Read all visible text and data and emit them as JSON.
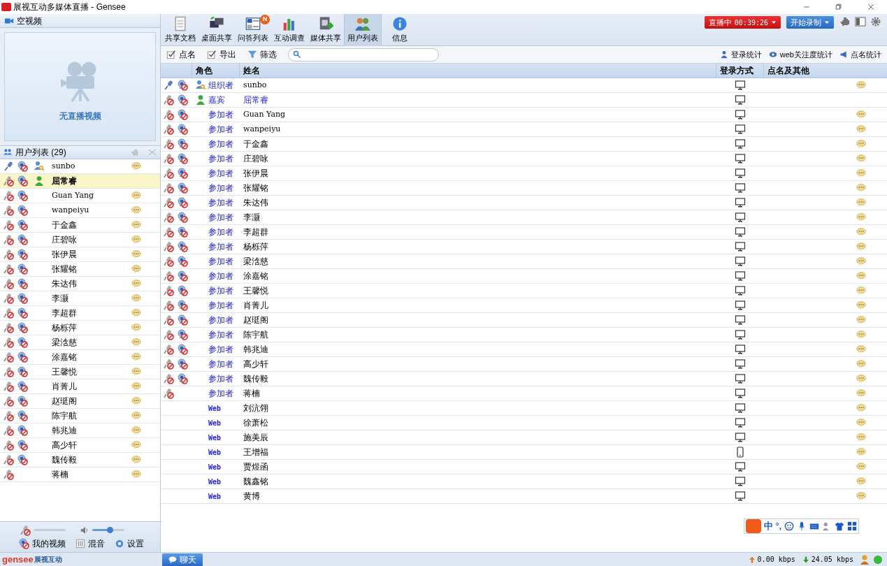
{
  "window": {
    "title": "展视互动多媒体直播 - Gensee"
  },
  "video_panel": {
    "title": "空视频",
    "empty_text": "无直播视频"
  },
  "user_panel": {
    "title": "用户列表 (29)",
    "users": [
      {
        "name": "sunbo",
        "kind": "organizer",
        "mic_on": true,
        "camera_blocked": true,
        "chat": true,
        "selected": false
      },
      {
        "name": "屈常睿",
        "kind": "guest",
        "mic_on": false,
        "camera_blocked": true,
        "chat": false,
        "selected": true
      },
      {
        "name": "Guan Yang",
        "kind": "attendee",
        "mic_on": false,
        "camera_blocked": true,
        "chat": true,
        "selected": false
      },
      {
        "name": "wanpeiyu",
        "kind": "attendee",
        "mic_on": false,
        "camera_blocked": true,
        "chat": true,
        "selected": false
      },
      {
        "name": "于金鑫",
        "kind": "attendee",
        "mic_on": false,
        "camera_blocked": true,
        "chat": true,
        "selected": false
      },
      {
        "name": "庄碧咏",
        "kind": "attendee",
        "mic_on": false,
        "camera_blocked": true,
        "chat": true,
        "selected": false
      },
      {
        "name": "张伊晨",
        "kind": "attendee",
        "mic_on": false,
        "camera_blocked": true,
        "chat": true,
        "selected": false
      },
      {
        "name": "张耀铭",
        "kind": "attendee",
        "mic_on": false,
        "camera_blocked": true,
        "chat": true,
        "selected": false
      },
      {
        "name": "朱达伟",
        "kind": "attendee",
        "mic_on": false,
        "camera_blocked": true,
        "chat": true,
        "selected": false
      },
      {
        "name": "李灏",
        "kind": "attendee",
        "mic_on": false,
        "camera_blocked": true,
        "chat": true,
        "selected": false
      },
      {
        "name": "李超群",
        "kind": "attendee",
        "mic_on": false,
        "camera_blocked": true,
        "chat": true,
        "selected": false
      },
      {
        "name": "杨栎萍",
        "kind": "attendee",
        "mic_on": false,
        "camera_blocked": true,
        "chat": true,
        "selected": false
      },
      {
        "name": "梁浛慈",
        "kind": "attendee",
        "mic_on": false,
        "camera_blocked": true,
        "chat": true,
        "selected": false
      },
      {
        "name": "涂嘉铭",
        "kind": "attendee",
        "mic_on": false,
        "camera_blocked": true,
        "chat": true,
        "selected": false
      },
      {
        "name": "王馨悦",
        "kind": "attendee",
        "mic_on": false,
        "camera_blocked": true,
        "chat": true,
        "selected": false
      },
      {
        "name": "肖菁儿",
        "kind": "attendee",
        "mic_on": false,
        "camera_blocked": true,
        "chat": true,
        "selected": false
      },
      {
        "name": "赵珽阁",
        "kind": "attendee",
        "mic_on": false,
        "camera_blocked": true,
        "chat": true,
        "selected": false
      },
      {
        "name": "陈宇航",
        "kind": "attendee",
        "mic_on": false,
        "camera_blocked": true,
        "chat": true,
        "selected": false
      },
      {
        "name": "韩兆迪",
        "kind": "attendee",
        "mic_on": false,
        "camera_blocked": true,
        "chat": true,
        "selected": false
      },
      {
        "name": "高少轩",
        "kind": "attendee",
        "mic_on": false,
        "camera_blocked": true,
        "chat": true,
        "selected": false
      },
      {
        "name": "魏传毅",
        "kind": "attendee",
        "mic_on": false,
        "camera_blocked": true,
        "chat": true,
        "selected": false
      },
      {
        "name": "蒋楠",
        "kind": "attendee",
        "mic_on": false,
        "camera_blocked": false,
        "chat": true,
        "selected": false
      }
    ]
  },
  "bottom_controls": {
    "mic_slider": {
      "level": 0
    },
    "speaker_slider": {
      "level": 0.55
    },
    "buttons": [
      "我的视频",
      "混音",
      "设置"
    ]
  },
  "toolbar": [
    {
      "label": "共享文档",
      "kind": "doc",
      "selected": false
    },
    {
      "label": "桌面共享",
      "kind": "desktop",
      "selected": false
    },
    {
      "label": "问答列表",
      "kind": "qa",
      "selected": false,
      "badge": "N"
    },
    {
      "label": "互动调查",
      "kind": "survey",
      "selected": false
    },
    {
      "label": "媒体共享",
      "kind": "media",
      "selected": false
    },
    {
      "label": "用户列表",
      "kind": "users",
      "selected": true
    },
    {
      "label": "信息",
      "kind": "info",
      "selected": false
    }
  ],
  "live_button": {
    "label": "直播中",
    "time": "00:39:26"
  },
  "record_button": {
    "label": "开始录制"
  },
  "sub_toolbar": {
    "actions": [
      "点名",
      "导出"
    ],
    "filter": "筛选",
    "stats": [
      "登录统计",
      "web关注度统计",
      "点名统计"
    ]
  },
  "table": {
    "columns": [
      "角色",
      "姓名",
      "登录方式",
      "点名及其他"
    ],
    "rows": [
      {
        "kind": "organizer",
        "role": "组织者",
        "name": "sunbo",
        "name_highlight": false,
        "mic_on": true,
        "camera_blocked": true,
        "mobile": false,
        "chat": true
      },
      {
        "kind": "guest",
        "role": "嘉宾",
        "name": "屈常睿",
        "name_highlight": true,
        "mic_on": false,
        "camera_blocked": true,
        "mobile": false,
        "chat": false
      },
      {
        "kind": "attendee",
        "role": "参加者",
        "name": "Guan Yang",
        "name_highlight": false,
        "mic_on": false,
        "camera_blocked": true,
        "mobile": false,
        "chat": true
      },
      {
        "kind": "attendee",
        "role": "参加者",
        "name": "wanpeiyu",
        "name_highlight": false,
        "mic_on": false,
        "camera_blocked": true,
        "mobile": false,
        "chat": true
      },
      {
        "kind": "attendee",
        "role": "参加者",
        "name": "于金鑫",
        "name_highlight": false,
        "mic_on": false,
        "camera_blocked": true,
        "mobile": false,
        "chat": true
      },
      {
        "kind": "attendee",
        "role": "参加者",
        "name": "庄碧咏",
        "name_highlight": false,
        "mic_on": false,
        "camera_blocked": true,
        "mobile": false,
        "chat": true
      },
      {
        "kind": "attendee",
        "role": "参加者",
        "name": "张伊晨",
        "name_highlight": false,
        "mic_on": false,
        "camera_blocked": true,
        "mobile": false,
        "chat": true
      },
      {
        "kind": "attendee",
        "role": "参加者",
        "name": "张耀铭",
        "name_highlight": false,
        "mic_on": false,
        "camera_blocked": true,
        "mobile": false,
        "chat": true
      },
      {
        "kind": "attendee",
        "role": "参加者",
        "name": "朱达伟",
        "name_highlight": false,
        "mic_on": false,
        "camera_blocked": true,
        "mobile": false,
        "chat": true
      },
      {
        "kind": "attendee",
        "role": "参加者",
        "name": "李灏",
        "name_highlight": false,
        "mic_on": false,
        "camera_blocked": true,
        "mobile": false,
        "chat": true
      },
      {
        "kind": "attendee",
        "role": "参加者",
        "name": "李超群",
        "name_highlight": false,
        "mic_on": false,
        "camera_blocked": true,
        "mobile": false,
        "chat": true
      },
      {
        "kind": "attendee",
        "role": "参加者",
        "name": "杨栎萍",
        "name_highlight": false,
        "mic_on": false,
        "camera_blocked": true,
        "mobile": false,
        "chat": true
      },
      {
        "kind": "attendee",
        "role": "参加者",
        "name": "梁浛慈",
        "name_highlight": false,
        "mic_on": false,
        "camera_blocked": true,
        "mobile": false,
        "chat": true
      },
      {
        "kind": "attendee",
        "role": "参加者",
        "name": "涂嘉铭",
        "name_highlight": false,
        "mic_on": false,
        "camera_blocked": true,
        "mobile": false,
        "chat": true
      },
      {
        "kind": "attendee",
        "role": "参加者",
        "name": "王馨悦",
        "name_highlight": false,
        "mic_on": false,
        "camera_blocked": true,
        "mobile": false,
        "chat": true
      },
      {
        "kind": "attendee",
        "role": "参加者",
        "name": "肖菁儿",
        "name_highlight": false,
        "mic_on": false,
        "camera_blocked": true,
        "mobile": false,
        "chat": true
      },
      {
        "kind": "attendee",
        "role": "参加者",
        "name": "赵珽阁",
        "name_highlight": false,
        "mic_on": false,
        "camera_blocked": true,
        "mobile": false,
        "chat": true
      },
      {
        "kind": "attendee",
        "role": "参加者",
        "name": "陈宇航",
        "name_highlight": false,
        "mic_on": false,
        "camera_blocked": true,
        "mobile": false,
        "chat": true
      },
      {
        "kind": "attendee",
        "role": "参加者",
        "name": "韩兆迪",
        "name_highlight": false,
        "mic_on": false,
        "camera_blocked": true,
        "mobile": false,
        "chat": true
      },
      {
        "kind": "attendee",
        "role": "参加者",
        "name": "高少轩",
        "name_highlight": false,
        "mic_on": false,
        "camera_blocked": true,
        "mobile": false,
        "chat": true
      },
      {
        "kind": "attendee",
        "role": "参加者",
        "name": "魏传毅",
        "name_highlight": false,
        "mic_on": false,
        "camera_blocked": true,
        "mobile": false,
        "chat": true
      },
      {
        "kind": "attendee",
        "role": "参加者",
        "name": "蒋楠",
        "name_highlight": false,
        "mic_on": false,
        "camera_blocked": false,
        "mobile": false,
        "chat": true
      },
      {
        "kind": "web",
        "role": "Web",
        "name": "刘沆翎",
        "name_highlight": false,
        "mobile": false,
        "chat": true
      },
      {
        "kind": "web",
        "role": "Web",
        "name": "徐萧松",
        "name_highlight": false,
        "mobile": false,
        "chat": true
      },
      {
        "kind": "web",
        "role": "Web",
        "name": "施美辰",
        "name_highlight": false,
        "mobile": false,
        "chat": true
      },
      {
        "kind": "web",
        "role": "Web",
        "name": "王增福",
        "name_highlight": false,
        "mobile": true,
        "chat": true
      },
      {
        "kind": "web",
        "role": "Web",
        "name": "贾煜函",
        "name_highlight": false,
        "mobile": false,
        "chat": true
      },
      {
        "kind": "web",
        "role": "Web",
        "name": "魏鑫铭",
        "name_highlight": false,
        "mobile": false,
        "chat": true
      },
      {
        "kind": "web",
        "role": "Web",
        "name": "黄博",
        "name_highlight": false,
        "mobile": false,
        "chat": true
      }
    ]
  },
  "ime_bar": {
    "mode": "中",
    "punct": "°,"
  },
  "status_bar": {
    "logo": "gensee",
    "logo_cn": "展视互动",
    "chat_tab": "聊天",
    "upload": "0.00 kbps",
    "download": "24.05 kbps"
  }
}
